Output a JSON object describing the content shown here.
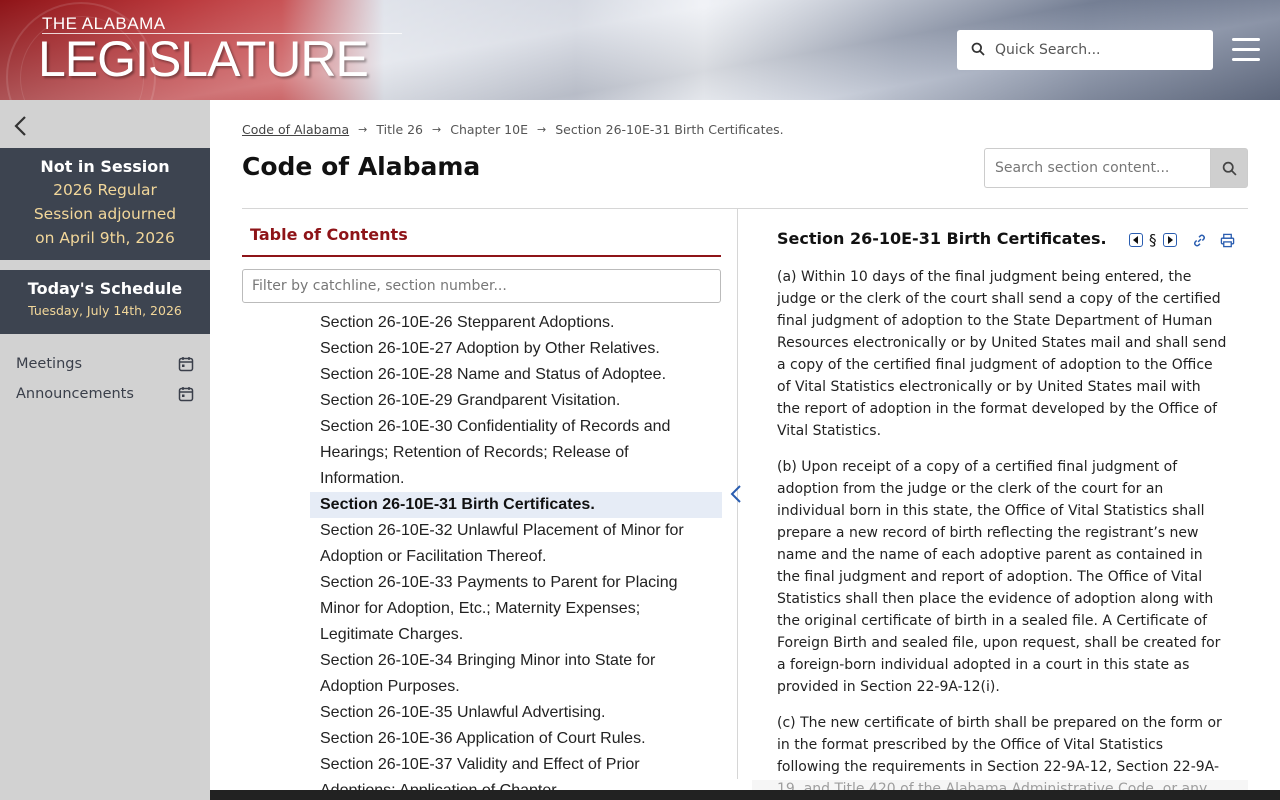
{
  "header": {
    "logo_top": "THE ALABAMA",
    "logo_main": "LEGISLATURE",
    "search_placeholder": "Quick Search..."
  },
  "sidebar": {
    "session_title": "Not in Session",
    "session_lines": [
      "2026 Regular",
      "Session adjourned",
      "on April 9th, 2026"
    ],
    "schedule_title": "Today's Schedule",
    "schedule_date": "Tuesday, July 14th, 2026",
    "links": [
      {
        "label": "Meetings",
        "icon": "calendar-icon"
      },
      {
        "label": "Announcements",
        "icon": "calendar-icon"
      }
    ]
  },
  "breadcrumb": {
    "root": "Code of Alabama",
    "items": [
      "Title 26",
      "Chapter 10E",
      "Section 26-10E-31 Birth Certificates."
    ]
  },
  "page_title": "Code of Alabama",
  "section_search_placeholder": "Search section content...",
  "toc": {
    "title": "Table of Contents",
    "filter_placeholder": "Filter by catchline, section number...",
    "items": [
      {
        "lines": [
          "Section 26-10E-26 Stepparent Adoptions."
        ],
        "active": false
      },
      {
        "lines": [
          "Section 26-10E-27 Adoption by Other Relatives."
        ],
        "active": false
      },
      {
        "lines": [
          "Section 26-10E-28 Name and Status of Adoptee."
        ],
        "active": false
      },
      {
        "lines": [
          "Section 26-10E-29 Grandparent Visitation."
        ],
        "active": false
      },
      {
        "lines": [
          "Section 26-10E-30 Confidentiality of Records and",
          "Hearings; Retention of Records; Release of",
          "Information."
        ],
        "active": false
      },
      {
        "lines": [
          "Section 26-10E-31 Birth Certificates."
        ],
        "active": true
      },
      {
        "lines": [
          "Section 26-10E-32 Unlawful Placement of Minor for",
          "Adoption or Facilitation Thereof."
        ],
        "active": false
      },
      {
        "lines": [
          "Section 26-10E-33 Payments to Parent for Placing",
          "Minor for Adoption, Etc.; Maternity Expenses;",
          "Legitimate Charges."
        ],
        "active": false
      },
      {
        "lines": [
          "Section 26-10E-34 Bringing Minor into State for",
          "Adoption Purposes."
        ],
        "active": false
      },
      {
        "lines": [
          "Section 26-10E-35 Unlawful Advertising."
        ],
        "active": false
      },
      {
        "lines": [
          "Section 26-10E-36 Application of Court Rules."
        ],
        "active": false
      },
      {
        "lines": [
          "Section 26-10E-37 Validity and Effect of Prior",
          "Adoptions; Application of Chapter."
        ],
        "active": false
      }
    ]
  },
  "section": {
    "heading": "Section 26-10E-31 Birth Certificates.",
    "symbol": "§",
    "paragraphs": [
      "(a) Within 10 days of the final judgment being entered, the judge or the clerk of the court shall send a copy of the certified final judgment of adoption to the State Department of Human Resources electronically or by United States mail and shall send a copy of the certified final judgment of adoption to the Office of Vital Statistics electronically or by United States mail with the report of adoption in the format developed by the Office of Vital Statistics.",
      "(b) Upon receipt of a copy of a certified final judgment of adoption from the judge or the clerk of the court for an individual born in this state, the Office of Vital Statistics shall prepare a new record of birth reflecting the registrant’s new name and the name of each adoptive parent as contained in the final judgment and report of adoption. The Office of Vital Statistics shall then place the evidence of adoption along with the original certificate of birth in a sealed file. A Certificate of Foreign Birth and sealed file, upon request, shall be created for a foreign-born individual adopted in a court in this state as provided in Section 22-9A-12(i).",
      "(c) The new certificate of birth shall be prepared on the form or in the format prescribed by the Office of Vital Statistics following the requirements in Section 22-9A-12, Section 22-9A-19, and Title 420 of the Alabama Administrative Code, or any"
    ]
  }
}
